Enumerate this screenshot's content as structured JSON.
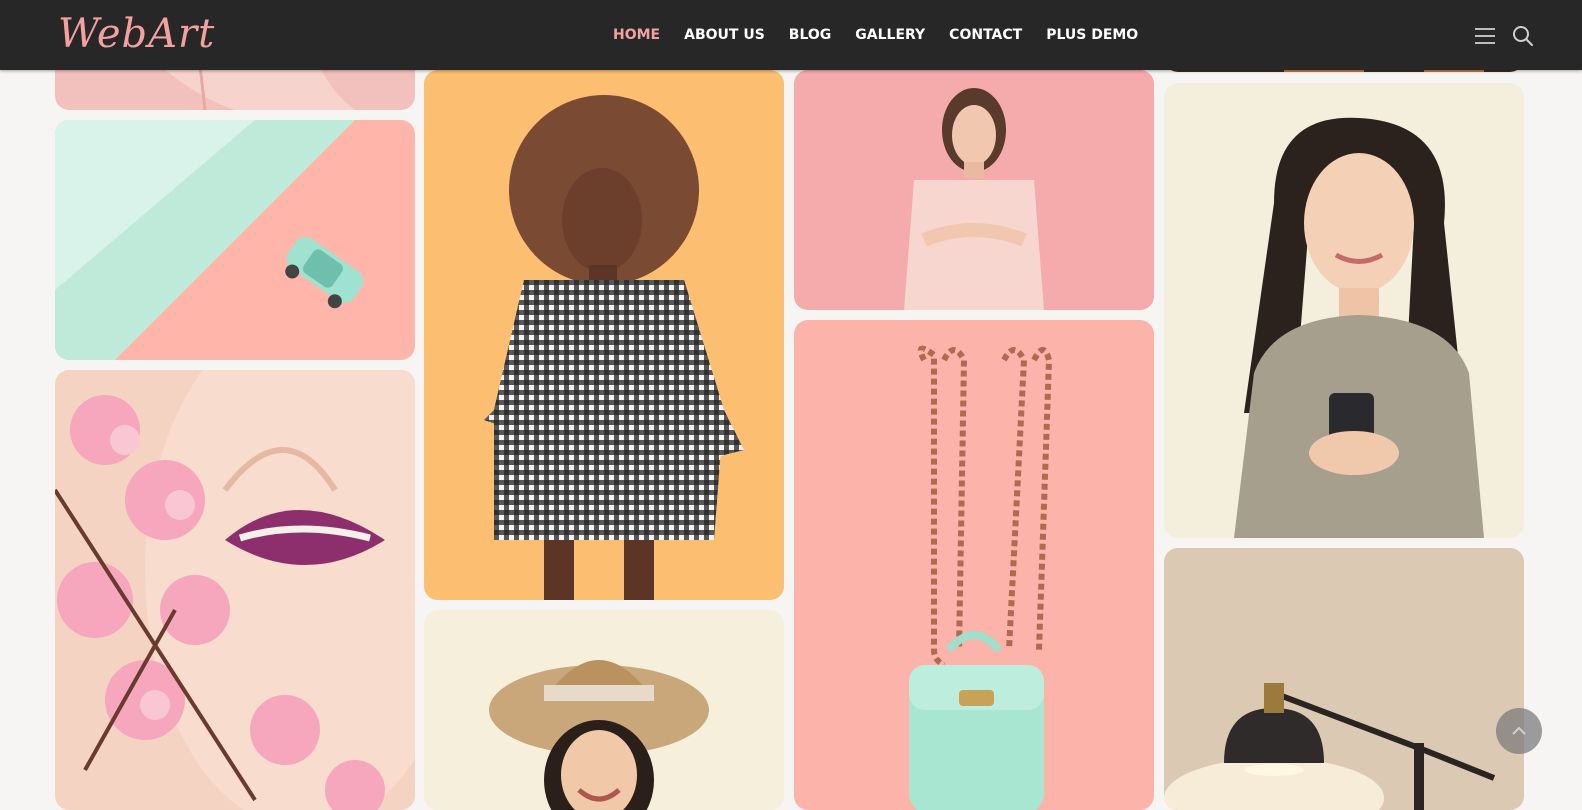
{
  "brand": {
    "logo_text": "WebArt",
    "accent": "#f2a1a0"
  },
  "nav": {
    "items": [
      {
        "label": "HOME",
        "active": true
      },
      {
        "label": "ABOUT US",
        "active": false
      },
      {
        "label": "BLOG",
        "active": false
      },
      {
        "label": "GALLERY",
        "active": false
      },
      {
        "label": "CONTACT",
        "active": false
      },
      {
        "label": "PLUS DEMO",
        "active": false
      }
    ],
    "menu_icon": "hamburger-icon",
    "search_icon": "search-icon"
  },
  "gallery": {
    "images": [
      {
        "name": "pink-shirt-crop",
        "subject": "pink top cropped"
      },
      {
        "name": "toy-car",
        "subject": "mint toy car on pink and mint background"
      },
      {
        "name": "purple-lips-flowers",
        "subject": "face with purple lips and pink blossoms"
      },
      {
        "name": "gingham-dress-woman",
        "subject": "woman in gingham dress on orange background"
      },
      {
        "name": "straw-hat-girl",
        "subject": "smiling girl with straw hat"
      },
      {
        "name": "pink-dress-woman",
        "subject": "woman in pink dress on pink background"
      },
      {
        "name": "mint-bag",
        "subject": "mint backpack with chain straps on pink"
      },
      {
        "name": "phone-woman",
        "subject": "woman holding phone on cream background"
      },
      {
        "name": "black-lamp",
        "subject": "black desk lamp on beige"
      }
    ]
  },
  "back_to_top_icon": "chevron-up-icon"
}
